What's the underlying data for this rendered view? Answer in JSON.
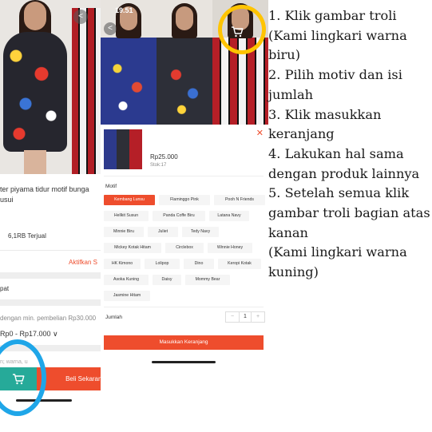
{
  "left_screen": {
    "product_title": "ter piyama tidur motif bunga",
    "product_title_line2": "usui",
    "sold_count": "6,1RB Terjual",
    "activate_link": "Aktifkan S",
    "pattern_label": "pat",
    "min_purchase_text": "dengan min. pembelian Rp30.000",
    "price_range": "Rp0 - Rp17.000 ∨",
    "note_placeholder": "n; warna, u",
    "buy_now_label": "Beli Sekarang",
    "highlight_color": "#1fa6e8"
  },
  "right_screen": {
    "status_time": "19.51",
    "price": "Rp25.000",
    "stock": "Stok:17",
    "close_symbol": "✕",
    "motif_label": "Motif",
    "motif_options": [
      {
        "label": "Kembang Lunsu",
        "selected": true
      },
      {
        "label": "Flaminggo Pink",
        "selected": false
      },
      {
        "label": "Pooh N Friends",
        "selected": false
      },
      {
        "label": "Hellkit Susun",
        "selected": false
      },
      {
        "label": "Panda Coffe Biru",
        "selected": false
      },
      {
        "label": "Latana Navy",
        "selected": false
      },
      {
        "label": "Minnie Biru",
        "selected": false
      },
      {
        "label": "Juliet",
        "selected": false
      },
      {
        "label": "Tedy Navy",
        "selected": false
      },
      {
        "label": "Mickey Kotak Hitam",
        "selected": false
      },
      {
        "label": "Circlebox",
        "selected": false
      },
      {
        "label": "Winnie Honey",
        "selected": false
      },
      {
        "label": "HK Kimono",
        "selected": false
      },
      {
        "label": "Lolipop",
        "selected": false
      },
      {
        "label": "Dino",
        "selected": false
      },
      {
        "label": "Keropi Kotak",
        "selected": false
      },
      {
        "label": "Asoka Kuning",
        "selected": false
      },
      {
        "label": "Daisy",
        "selected": false
      },
      {
        "label": "Mommy Bear",
        "selected": false
      },
      {
        "label": "Jasmine Hitam",
        "selected": false
      }
    ],
    "quantity_label": "Jumlah",
    "quantity_minus": "−",
    "quantity_value": "1",
    "quantity_plus": "+",
    "add_to_cart_label": "Masukkan Keranjang",
    "highlight_color": "#ffc400",
    "accent_color": "#ee4d2d"
  },
  "instructions": {
    "lines": [
      "1. Klik gambar troli",
      "(Kami lingkari warna",
      "biru)",
      "2. Pilih motiv dan isi",
      "jumlah",
      "3. Klik masukkan",
      "keranjang",
      "4. Lakukan hal sama",
      "dengan produk lainnya",
      "5. Setelah semua klik",
      "gambar troli bagian atas",
      "kanan",
      "(Kami lingkari warna",
      "kuning)"
    ]
  }
}
